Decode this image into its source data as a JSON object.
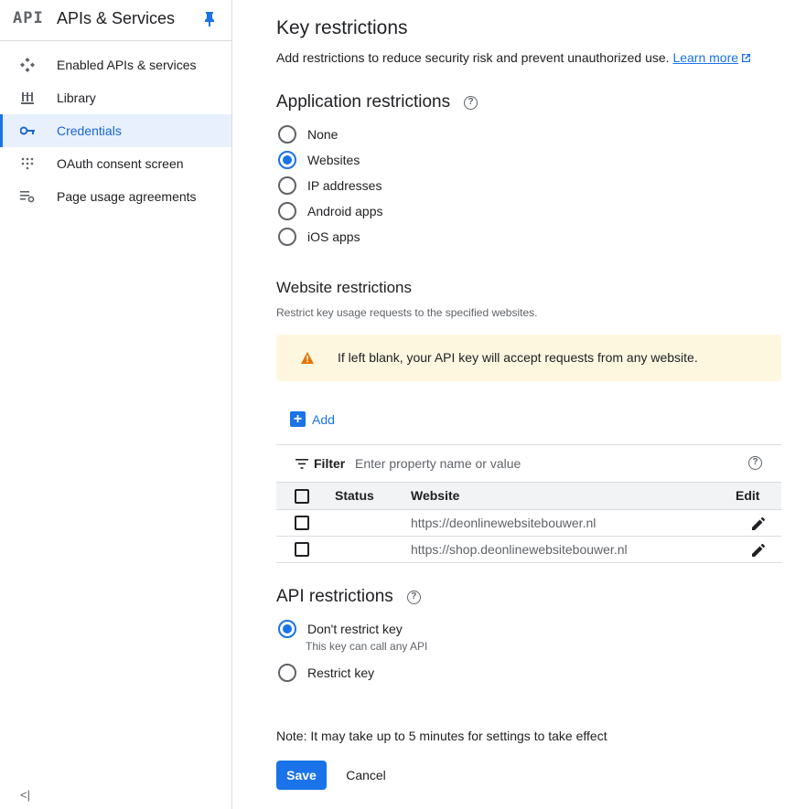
{
  "sidebar": {
    "logo": "API",
    "title": "APIs & Services",
    "items": [
      {
        "label": "Enabled APIs & services",
        "icon": "enabled-apis-icon",
        "active": false
      },
      {
        "label": "Library",
        "icon": "library-icon",
        "active": false
      },
      {
        "label": "Credentials",
        "icon": "key-icon",
        "active": true
      },
      {
        "label": "OAuth consent screen",
        "icon": "oauth-icon",
        "active": false
      },
      {
        "label": "Page usage agreements",
        "icon": "page-settings-icon",
        "active": false
      }
    ],
    "collapse_label": "<|"
  },
  "main": {
    "title": "Key restrictions",
    "description": "Add restrictions to reduce security risk and prevent unauthorized use.",
    "learn_more": "Learn more",
    "app_restrictions": {
      "title": "Application restrictions",
      "help": "?",
      "options": [
        "None",
        "Websites",
        "IP addresses",
        "Android apps",
        "iOS apps"
      ],
      "selected": "Websites"
    },
    "website_restrictions": {
      "title": "Website restrictions",
      "description": "Restrict key usage requests to the specified websites.",
      "warning": "If left blank, your API key will accept requests from any website.",
      "add_label": "Add",
      "filter_label": "Filter",
      "filter_placeholder": "Enter property name or value",
      "columns": {
        "status": "Status",
        "website": "Website",
        "edit": "Edit"
      },
      "rows": [
        {
          "status": "",
          "website": "https://deonlinewebsitebouwer.nl"
        },
        {
          "status": "",
          "website": "https://shop.deonlinewebsitebouwer.nl"
        }
      ]
    },
    "api_restrictions": {
      "title": "API restrictions",
      "help": "?",
      "options": [
        {
          "label": "Don't restrict key",
          "sublabel": "This key can call any API",
          "selected": true
        },
        {
          "label": "Restrict key",
          "sublabel": "",
          "selected": false
        }
      ]
    },
    "note": "Note: It may take up to 5 minutes for settings to take effect",
    "save_label": "Save",
    "cancel_label": "Cancel"
  },
  "colors": {
    "accent": "#1a73e8",
    "active_bg": "#e8f0fe",
    "warning_bg": "#fef7e0",
    "warning_icon": "#e37400"
  }
}
